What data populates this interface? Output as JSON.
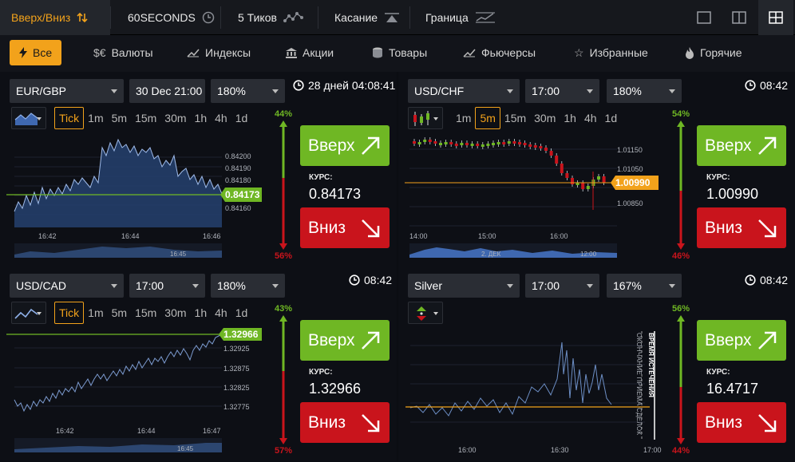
{
  "top_tabs": [
    {
      "label": "Вверх/Вниз"
    },
    {
      "label": "60SECONDS"
    },
    {
      "label": "5 Тиков"
    },
    {
      "label": "Касание"
    },
    {
      "label": "Граница"
    }
  ],
  "filters": [
    {
      "label": "Все"
    },
    {
      "label": "Валюты"
    },
    {
      "label": "Индексы"
    },
    {
      "label": "Акции"
    },
    {
      "label": "Товары"
    },
    {
      "label": "Фьючерсы"
    },
    {
      "label": "Избранные"
    },
    {
      "label": "Горячие"
    }
  ],
  "panels": [
    {
      "asset": "EUR/GBP",
      "expiry": "30 Dec 21:00",
      "payout": "180%",
      "countdown": "28 дней 04:08:41",
      "up_pct": "44%",
      "down_pct": "56%",
      "up_label": "Вверх",
      "down_label": "Вниз",
      "kurs_label": "КУРС:",
      "rate": "0.84173",
      "price_tag": "0.84173",
      "timeframes": [
        "Tick",
        "1m",
        "5m",
        "15m",
        "30m",
        "1h",
        "4h",
        "1d"
      ],
      "active_tf": "Tick",
      "y_ticks": [
        "0.84200",
        "0.84190",
        "0.84180",
        "0.84160"
      ],
      "x_ticks": [
        "16:42",
        "16:44",
        "16:46"
      ],
      "nav_label": "16:45"
    },
    {
      "asset": "USD/CHF",
      "expiry": "17:00",
      "payout": "180%",
      "countdown": "08:42",
      "up_pct": "54%",
      "down_pct": "46%",
      "up_label": "Вверх",
      "down_label": "Вниз",
      "kurs_label": "КУРС:",
      "rate": "1.00990",
      "price_tag": "1.00990",
      "timeframes": [
        "1m",
        "5m",
        "15m",
        "30m",
        "1h",
        "4h",
        "1d"
      ],
      "active_tf": "5m",
      "y_ticks": [
        "1.01150",
        "1.01050",
        "1.00850"
      ],
      "x_ticks": [
        "14:00",
        "15:00",
        "16:00"
      ],
      "nav_label": "2. ДЕК",
      "nav_label2": "12:00"
    },
    {
      "asset": "USD/CAD",
      "expiry": "17:00",
      "payout": "180%",
      "countdown": "08:42",
      "up_pct": "43%",
      "down_pct": "57%",
      "up_label": "Вверх",
      "down_label": "Вниз",
      "kurs_label": "КУРС:",
      "rate": "1.32966",
      "price_tag": "1.32966",
      "timeframes": [
        "Tick",
        "1m",
        "5m",
        "15m",
        "30m",
        "1h",
        "4h",
        "1d"
      ],
      "active_tf": "Tick",
      "y_ticks": [
        "1.32925",
        "1.32875",
        "1.32825",
        "1.32775"
      ],
      "x_ticks": [
        "16:42",
        "16:44",
        "16:47"
      ],
      "nav_label": "16:45"
    },
    {
      "asset": "Silver",
      "expiry": "17:00",
      "payout": "167%",
      "countdown": "08:42",
      "up_pct": "56%",
      "down_pct": "44%",
      "up_label": "Вверх",
      "down_label": "Вниз",
      "kurs_label": "КУРС:",
      "rate": "16.4717",
      "x_ticks": [
        "16:00",
        "16:30",
        "17:00"
      ],
      "end_of_purchase": "ОКОНЧАНИЕ ПРИЕМА СДЕЛОК",
      "expiry_time_label": "ВРЕМЯ ИСТЕЧЕНИЯ"
    }
  ],
  "colors": {
    "accent": "#f2a21b",
    "up": "#6fb724",
    "down": "#c9141c",
    "chart_line": "#6d8fc6",
    "price_line": "#6fb724",
    "silver_line": "#f2a21b"
  }
}
